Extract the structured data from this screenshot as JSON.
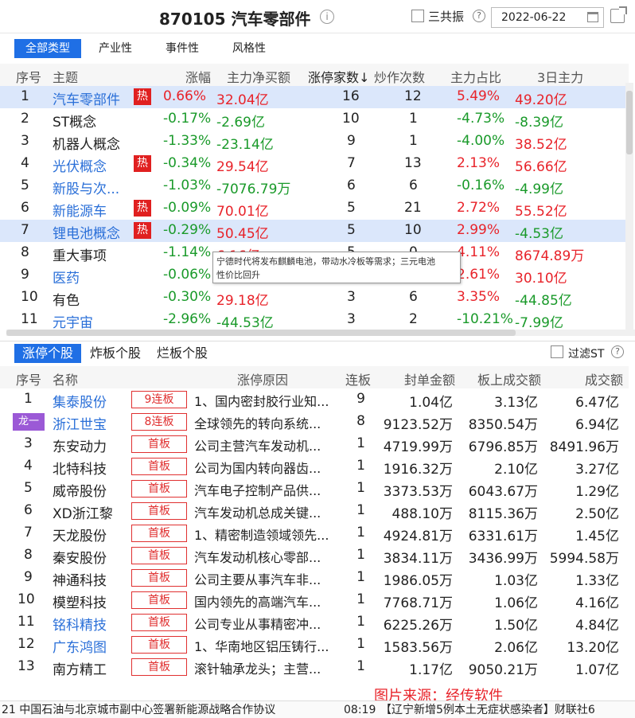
{
  "header": {
    "title": "870105 汽车零部件",
    "sanggong_label": "三共振",
    "date": "2022-06-22"
  },
  "filters": [
    "全部类型",
    "产业性",
    "事件性",
    "风格性"
  ],
  "concept_table": {
    "columns": [
      "序号",
      "主题",
      "涨幅",
      "主力净买额",
      "涨停家数↓",
      "炒作次数",
      "主力占比",
      "3日主力"
    ],
    "rows": [
      {
        "no": "1",
        "name": "汽车零部件",
        "hot": true,
        "chg": "0.66%",
        "net": "32.04亿",
        "limit": "16",
        "times": "12",
        "ratio": "5.49%",
        "d3": "49.20亿"
      },
      {
        "no": "2",
        "name": "ST概念",
        "hot": false,
        "chg": "-0.17%",
        "net": "-2.69亿",
        "limit": "10",
        "times": "1",
        "ratio": "-4.73%",
        "d3": "-8.39亿"
      },
      {
        "no": "3",
        "name": "机器人概念",
        "hot": false,
        "chg": "-1.33%",
        "net": "-23.14亿",
        "limit": "9",
        "times": "1",
        "ratio": "-4.00%",
        "d3": "38.52亿"
      },
      {
        "no": "4",
        "name": "光伏概念",
        "hot": true,
        "chg": "-0.34%",
        "net": "29.54亿",
        "limit": "7",
        "times": "13",
        "ratio": "2.13%",
        "d3": "56.66亿"
      },
      {
        "no": "5",
        "name": "新股与次...",
        "hot": false,
        "chg": "-1.03%",
        "net": "-7076.79万",
        "limit": "6",
        "times": "6",
        "ratio": "-0.16%",
        "d3": "-4.99亿"
      },
      {
        "no": "6",
        "name": "新能源车",
        "hot": true,
        "chg": "-0.09%",
        "net": "70.01亿",
        "limit": "5",
        "times": "21",
        "ratio": "2.72%",
        "d3": "55.52亿"
      },
      {
        "no": "7",
        "name": "锂电池概念",
        "hot": true,
        "chg": "-0.29%",
        "net": "50.45亿",
        "limit": "5",
        "times": "10",
        "ratio": "2.99%",
        "d3": "-4.53亿"
      },
      {
        "no": "8",
        "name": "重大事项",
        "hot": false,
        "chg": "-1.14%",
        "net": "6.16亿",
        "limit": "5",
        "times": "0",
        "ratio": "4.11%",
        "d3": "8674.89万"
      },
      {
        "no": "9",
        "name": "医药",
        "hot": false,
        "chg": "-0.06%",
        "net": "",
        "limit": "",
        "times": "",
        "ratio": "2.61%",
        "d3": "30.10亿"
      },
      {
        "no": "10",
        "name": "有色",
        "hot": false,
        "chg": "-0.30%",
        "net": "29.18亿",
        "limit": "3",
        "times": "6",
        "ratio": "3.35%",
        "d3": "-44.85亿"
      },
      {
        "no": "11",
        "name": "元宇宙",
        "hot": false,
        "chg": "-2.96%",
        "net": "-44.53亿",
        "limit": "3",
        "times": "2",
        "ratio": "-10.21%",
        "d3": "-7.99亿"
      }
    ],
    "hot_label": "热"
  },
  "tooltip": {
    "line1": "宁德时代将发布麒麟电池，带动水冷板等需求；三元电池",
    "line2": "性价比回升"
  },
  "stock_tabs": [
    "涨停个股",
    "炸板个股",
    "烂板个股"
  ],
  "filter_st": "过滤ST",
  "stock_table": {
    "columns": [
      "序号",
      "名称",
      "涨停原因",
      "连板",
      "封单金额",
      "板上成交额",
      "成交额"
    ],
    "dragon_label": "龙一",
    "rows": [
      {
        "no": "1",
        "name": "集泰股份",
        "badge": "9连板",
        "reason": "1、国内密封胶行业知...",
        "lb": "9",
        "seal": "1.04亿",
        "board": "3.13亿",
        "amount": "6.47亿"
      },
      {
        "no": "2",
        "name": "浙江世宝",
        "badge": "8连板",
        "reason": "全球领先的转向系统...",
        "lb": "8",
        "seal": "9123.52万",
        "board": "8350.54万",
        "amount": "6.94亿"
      },
      {
        "no": "3",
        "name": "东安动力",
        "badge": "首板",
        "reason": "公司主营汽车发动机...",
        "lb": "1",
        "seal": "4719.99万",
        "board": "6796.85万",
        "amount": "8491.96万"
      },
      {
        "no": "4",
        "name": "北特科技",
        "badge": "首板",
        "reason": "公司为国内转向器齿...",
        "lb": "1",
        "seal": "1916.32万",
        "board": "2.10亿",
        "amount": "3.27亿"
      },
      {
        "no": "5",
        "name": "威帝股份",
        "badge": "首板",
        "reason": "汽车电子控制产品供...",
        "lb": "1",
        "seal": "3373.53万",
        "board": "6043.67万",
        "amount": "1.29亿"
      },
      {
        "no": "6",
        "name": "XD浙江黎",
        "badge": "首板",
        "reason": "汽车发动机总成关键...",
        "lb": "1",
        "seal": "488.10万",
        "board": "8115.36万",
        "amount": "2.50亿"
      },
      {
        "no": "7",
        "name": "天龙股份",
        "badge": "首板",
        "reason": "1、精密制造领域领先...",
        "lb": "1",
        "seal": "4924.81万",
        "board": "6331.61万",
        "amount": "1.45亿"
      },
      {
        "no": "8",
        "name": "秦安股份",
        "badge": "首板",
        "reason": "汽车发动机核心零部...",
        "lb": "1",
        "seal": "3834.11万",
        "board": "3436.99万",
        "amount": "5994.58万"
      },
      {
        "no": "9",
        "name": "神通科技",
        "badge": "首板",
        "reason": "公司主要从事汽车非...",
        "lb": "1",
        "seal": "1986.05万",
        "board": "1.03亿",
        "amount": "1.33亿"
      },
      {
        "no": "10",
        "name": "模塑科技",
        "badge": "首板",
        "reason": "国内领先的高端汽车...",
        "lb": "1",
        "seal": "7768.71万",
        "board": "1.06亿",
        "amount": "4.16亿"
      },
      {
        "no": "11",
        "name": "铭科精技",
        "badge": "首板",
        "reason": "公司专业从事精密冲...",
        "lb": "1",
        "seal": "6225.26万",
        "board": "1.50亿",
        "amount": "4.84亿"
      },
      {
        "no": "12",
        "name": "广东鸿图",
        "badge": "首板",
        "reason": "1、华南地区铝压铸行...",
        "lb": "1",
        "seal": "1583.56万",
        "board": "2.06亿",
        "amount": "13.20亿"
      },
      {
        "no": "13",
        "name": "南方精工",
        "badge": "首板",
        "reason": "滚针轴承龙头；主营...",
        "lb": "1",
        "seal": "1.17亿",
        "board": "9050.21万",
        "amount": "1.07亿"
      }
    ]
  },
  "source_watermark": "图片来源：经传软件",
  "ticker": {
    "left": "21 中国石油与北京城市副中心签署新能源战略合作协议",
    "time": "08:19",
    "right": "【辽宁新增5例本土无症状感染者】财联社6"
  },
  "colors": {
    "up": "#e8232a",
    "down": "#1a9a2a",
    "link": "#2a6fd8",
    "accent": "#1f6fe5"
  }
}
